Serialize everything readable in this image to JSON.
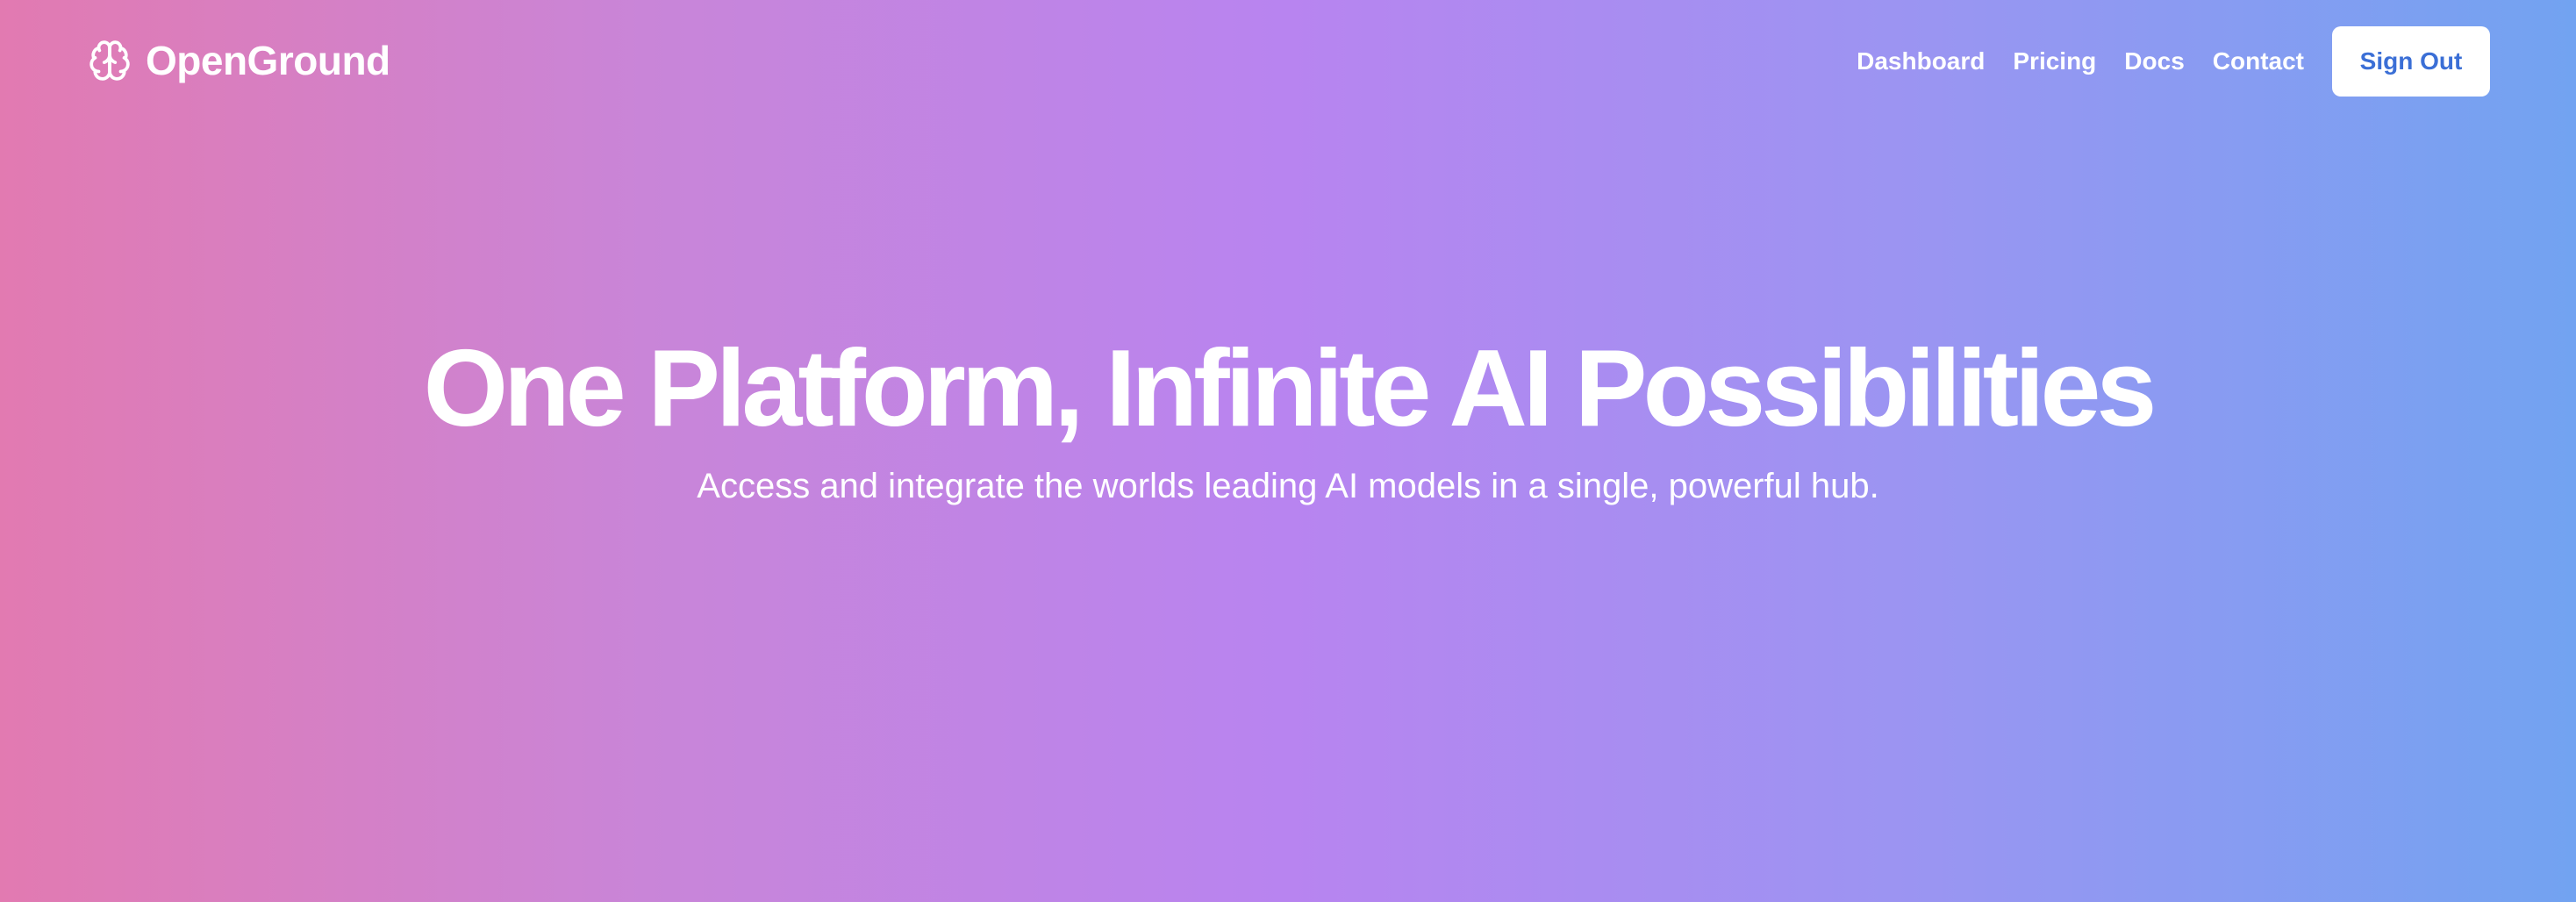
{
  "brand": {
    "name": "OpenGround",
    "icon": "brain-icon"
  },
  "nav": {
    "links": [
      {
        "label": "Dashboard"
      },
      {
        "label": "Pricing"
      },
      {
        "label": "Docs"
      },
      {
        "label": "Contact"
      }
    ],
    "sign_out_label": "Sign Out"
  },
  "hero": {
    "title": "One Platform, Infinite AI Possibilities",
    "subtitle": "Access and integrate the worlds leading AI models in a single, powerful hub."
  },
  "colors": {
    "gradient_start": "#e27ab1",
    "gradient_mid": "#b884f0",
    "gradient_end": "#72a3f1",
    "button_text": "#3b6fd6"
  }
}
